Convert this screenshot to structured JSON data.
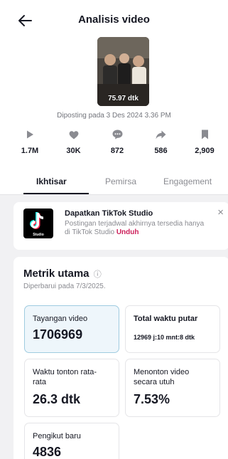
{
  "header": {
    "title": "Analisis video"
  },
  "video": {
    "duration": "75.97 dtk",
    "posted": "Diposting pada 3 Des 2024 3.36 PM"
  },
  "stats": [
    {
      "icon": "play-icon",
      "value": "1.7M"
    },
    {
      "icon": "heart-icon",
      "value": "30K"
    },
    {
      "icon": "comment-icon",
      "value": "872"
    },
    {
      "icon": "share-icon",
      "value": "586"
    },
    {
      "icon": "bookmark-icon",
      "value": "2,909"
    }
  ],
  "tabs": [
    {
      "label": "Ikhtisar",
      "active": true
    },
    {
      "label": "Pemirsa",
      "active": false
    },
    {
      "label": "Engagement",
      "active": false
    }
  ],
  "banner": {
    "title": "Dapatkan TikTok Studio",
    "text": "Postingan terjadwal akhirnya tersedia hanya di TikTok Studio",
    "link": "Unduh",
    "logo_text": "Studio",
    "close": "×"
  },
  "metrics": {
    "title": "Metrik utama",
    "info_icon": "ⓘ",
    "updated": "Diperbarui pada 7/3/2025.",
    "cards": [
      {
        "label": "Tayangan video",
        "value": "1706969"
      },
      {
        "label": "Total waktu putar",
        "value": "12969 j:10 mnt:8 dtk"
      },
      {
        "label": "Waktu tonton rata-rata",
        "value": "26.3 dtk"
      },
      {
        "label": "Menonton video secara utuh",
        "value": "7.53%"
      },
      {
        "label": "Pengikut baru",
        "value": "4836"
      }
    ]
  },
  "colors": {
    "accent_link": "#cc1f5a",
    "selected_card": "#eef6fb",
    "text": "#161823",
    "muted": "#8a8b91"
  }
}
